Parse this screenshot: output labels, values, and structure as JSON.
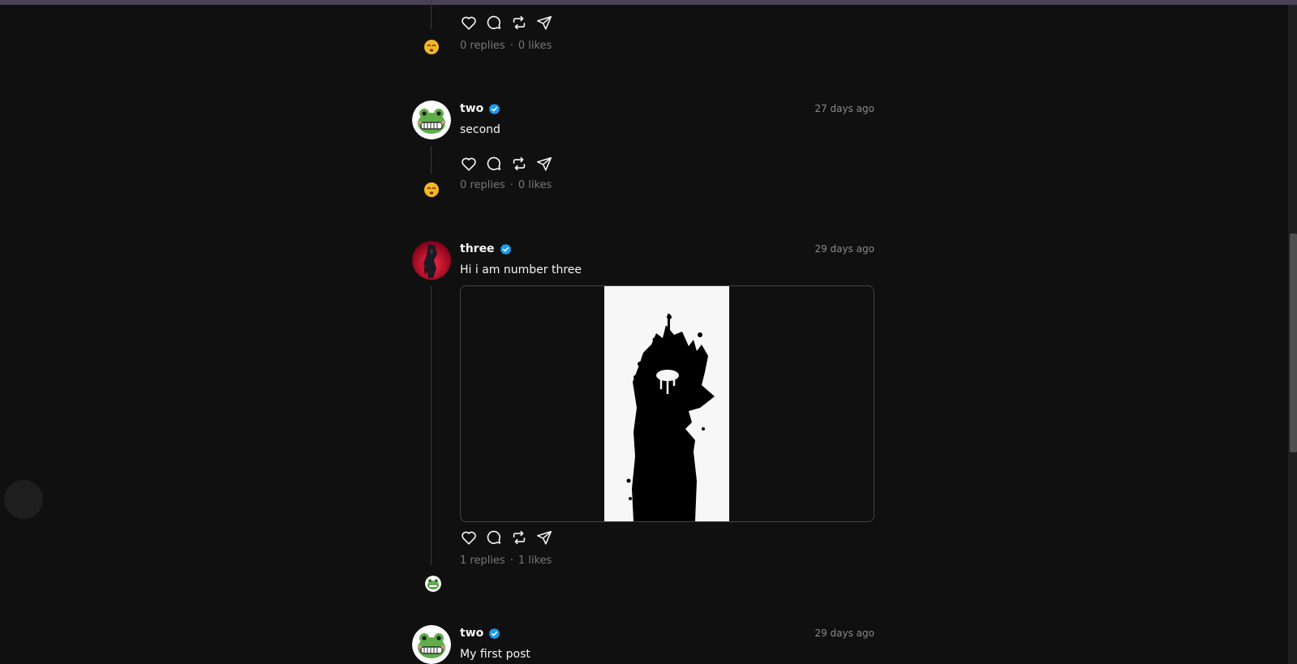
{
  "colors": {
    "background": "#101010",
    "text": "#f3f5f7",
    "muted": "#777777",
    "verified": "#1d9bf0",
    "title_bar": "#4a4157"
  },
  "icons": {
    "like": "heart-icon",
    "reply": "comment-icon",
    "repost": "repost-icon",
    "share": "send-icon",
    "verified": "verified-badge-icon"
  },
  "posts": [
    {
      "username": "",
      "time": "",
      "text": "",
      "replies": "0 replies",
      "likes": "0 likes"
    },
    {
      "username": "two",
      "time": "27 days ago",
      "text": "second",
      "replies": "0 replies",
      "likes": "0 likes"
    },
    {
      "username": "three",
      "time": "29 days ago",
      "text": "Hi i am number three",
      "replies": "1 replies",
      "likes": "1 likes",
      "has_image": true
    },
    {
      "username": "two",
      "time": "29 days ago",
      "text": "My first post"
    }
  ],
  "separator": "·"
}
